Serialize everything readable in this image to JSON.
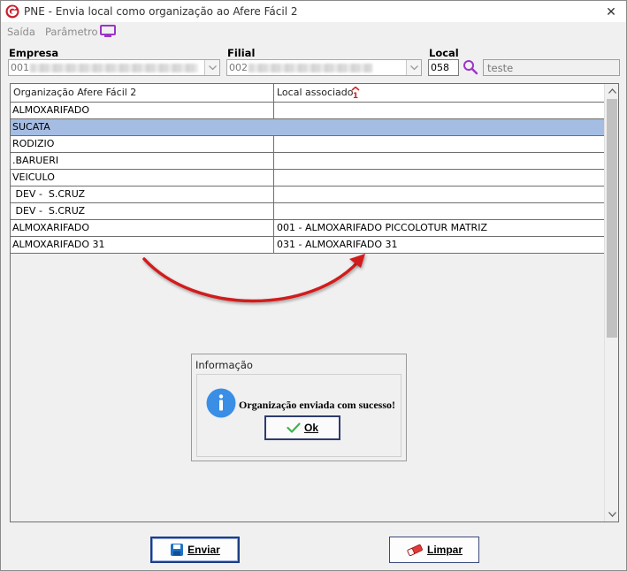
{
  "window": {
    "title": "PNE - Envia local como organização ao Afere Fácil 2",
    "close_glyph": "✕"
  },
  "menu": {
    "items": [
      "Saída",
      "Parâmetro"
    ],
    "extra_icon": "monitor-icon"
  },
  "filters": {
    "empresa": {
      "label": "Empresa",
      "value_prefix": "001"
    },
    "filial": {
      "label": "Filial",
      "value_prefix": "002"
    },
    "local": {
      "label": "Local",
      "code": "058",
      "description": "teste",
      "search_icon": "search-icon"
    }
  },
  "grid": {
    "columns": [
      "Organização Afere Fácil 2",
      "Local associado"
    ],
    "sort_indicator": "1",
    "selected_row_index": 1,
    "rows": [
      [
        "ALMOXARIFADO",
        ""
      ],
      [
        "SUCATA",
        ""
      ],
      [
        "RODIZIO",
        ""
      ],
      [
        ".BARUERI",
        ""
      ],
      [
        "VEICULO",
        ""
      ],
      [
        " DEV -  S.CRUZ",
        ""
      ],
      [
        " DEV -  S.CRUZ",
        ""
      ],
      [
        "ALMOXARIFADO",
        "001 - ALMOXARIFADO PICCOLOTUR MATRIZ"
      ],
      [
        "ALMOXARIFADO 31",
        "031 - ALMOXARIFADO 31"
      ]
    ]
  },
  "dialog": {
    "title": "Informação",
    "message": "Organização enviada com sucesso!",
    "ok_label": "Ok",
    "icon": "info-icon"
  },
  "buttons": {
    "enviar": "Enviar",
    "limpar": "Limpar"
  },
  "colors": {
    "selected_row": "#a6bde3",
    "accent_purple": "#9b35c8",
    "info_blue": "#3a8ee6",
    "arrow_red": "#d21e1e"
  }
}
